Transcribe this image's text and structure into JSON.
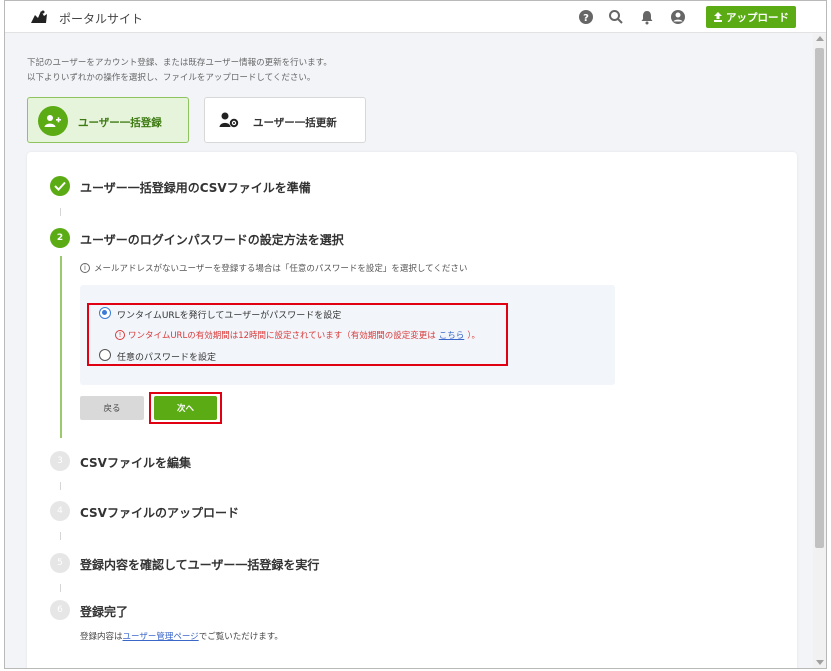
{
  "header": {
    "site_name": "ポータルサイト",
    "upload_label": "アップロード",
    "icons": [
      "help-icon",
      "search-icon",
      "bell-icon",
      "account-icon"
    ],
    "accent_color": "#5aab14"
  },
  "intro": {
    "line1": "下記のユーザーをアカウント登録、または既存ユーザー情報の更新を行います。",
    "line2": "以下よりいずれかの操作を選択し、ファイルをアップロードしてください。"
  },
  "mode_tabs": [
    {
      "label": "ユーザー一括登録",
      "selected": true
    },
    {
      "label": "ユーザー一括更新",
      "selected": false
    }
  ],
  "steps": [
    {
      "number": "",
      "status": "done",
      "title": "ユーザー一括登録用のCSVファイルを準備"
    },
    {
      "number": "2",
      "status": "active",
      "title": "ユーザーのログインパスワードの設定方法を選択"
    },
    {
      "number": "3",
      "status": "todo",
      "title": "CSVファイルを編集"
    },
    {
      "number": "4",
      "status": "todo",
      "title": "CSVファイルのアップロード"
    },
    {
      "number": "5",
      "status": "todo",
      "title": "登録内容を確認してユーザー一括登録を実行"
    },
    {
      "number": "6",
      "status": "todo",
      "title": "登録完了"
    }
  ],
  "password_step": {
    "info": "メールアドレスがないユーザーを登録する場合は「任意のパスワードを設定」を選択してください",
    "options": [
      {
        "label": "ワンタイムURLを発行してユーザーがパスワードを設定",
        "checked": true
      },
      {
        "label": "任意のパスワードを設定",
        "checked": false
      }
    ],
    "warning_prefix": "ワンタイムURLの有効期間は12時間に設定されています（有効期間の設定変更は",
    "warning_link": "こちら",
    "warning_suffix": "）。",
    "back_label": "戻る",
    "next_label": "次へ"
  },
  "complete_note": {
    "prefix": "登録内容は",
    "link": "ユーザー管理ページ",
    "suffix": "でご覧いただけます。"
  }
}
